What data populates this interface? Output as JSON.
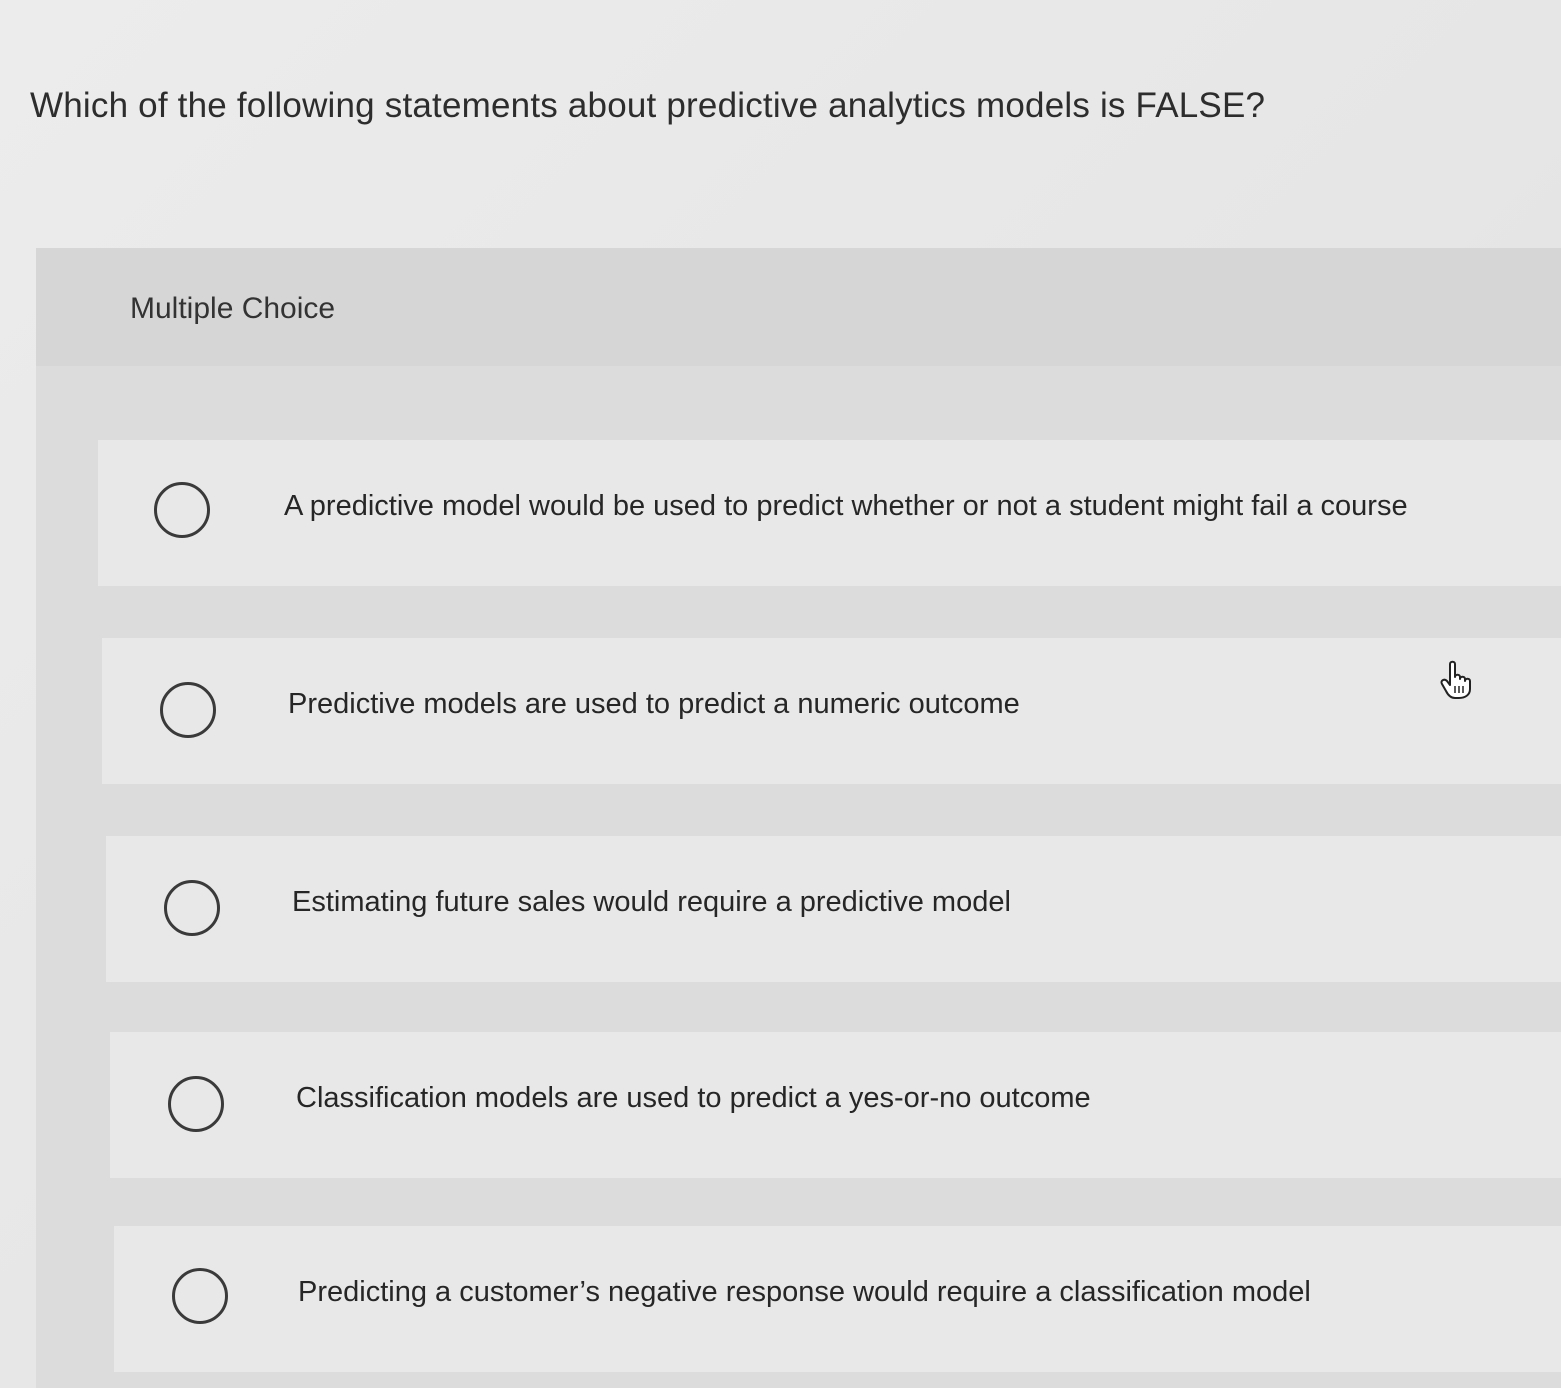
{
  "question": {
    "text": "Which of the following statements about predictive analytics models is FALSE?"
  },
  "panel": {
    "label": "Multiple Choice"
  },
  "options": [
    {
      "label": "A predictive model would be used to predict whether or not a student might fail a course",
      "selected": false
    },
    {
      "label": "Predictive models are used to predict a numeric outcome",
      "selected": false
    },
    {
      "label": "Estimating future sales would require a predictive model",
      "selected": false
    },
    {
      "label": "Classification models are used to predict a yes-or-no outcome",
      "selected": false
    },
    {
      "label": "Predicting a customer’s negative response would require a classification model",
      "selected": false
    }
  ],
  "icons": {
    "cursor": "hand-pointer-icon",
    "radio": "radio-unselected-icon"
  },
  "colors": {
    "page_bg": "#e6e6e6",
    "panel_bg": "#dcdcdc",
    "option_bg": "#e8e8e8",
    "text": "#2a2a2a",
    "radio_border": "#3a3a3a"
  }
}
